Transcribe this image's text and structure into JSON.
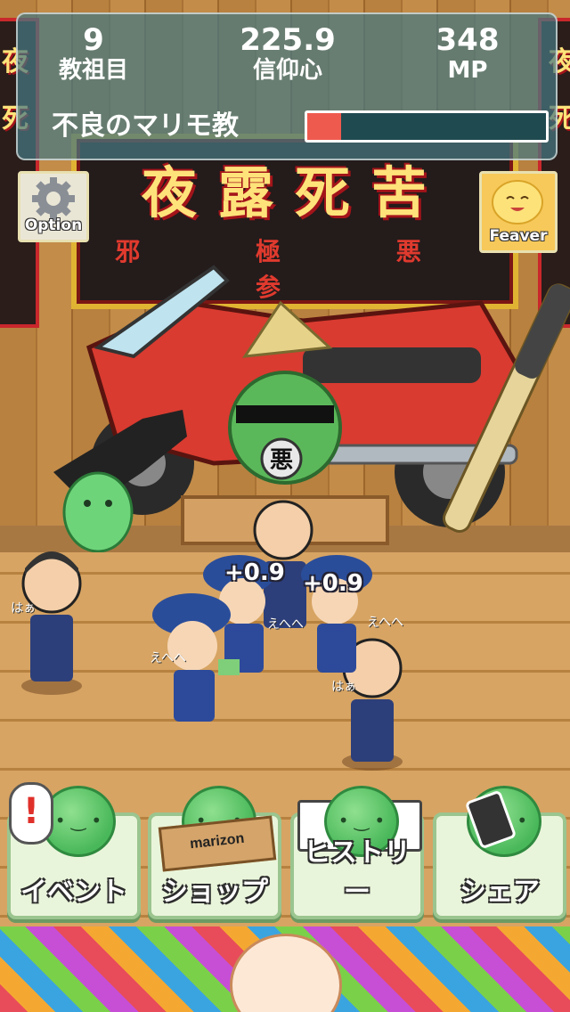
{
  "hud": {
    "stats": [
      {
        "value": "9",
        "label": "教祖目"
      },
      {
        "value": "225.9",
        "label": "信仰心"
      },
      {
        "value": "348",
        "label": "MP"
      }
    ],
    "cult_name": "不良のマリモ教",
    "progress": 0.14,
    "progress_color": "#ef5a4e"
  },
  "corner_buttons": {
    "option_label": "Option",
    "feaver_label": "Feaver"
  },
  "banner": {
    "main": "夜露死苦",
    "sub": "邪 極 悪 参"
  },
  "side_banners": {
    "left": [
      "夜",
      "死"
    ],
    "right": [
      "夜",
      "死"
    ]
  },
  "scene": {
    "marimo_mask_text": "悪",
    "floaters": [
      "+0.9",
      "+0.9"
    ],
    "murmurs": [
      "はぁ",
      "えへへ",
      "えへへ",
      "えへへ",
      "はぁ"
    ]
  },
  "menu": {
    "buttons": [
      {
        "label": "イベント",
        "icon": "alert-bubble-icon"
      },
      {
        "label": "ショップ",
        "icon": "box-icon"
      },
      {
        "label": "ヒストリー",
        "icon": "book-icon"
      },
      {
        "label": "シェア",
        "icon": "phone-icon"
      }
    ],
    "box_text": "marizon",
    "alert_mark": "!"
  },
  "colors": {
    "hud_bg": "#467882",
    "menu_green": "#49b85a",
    "banner_gold": "#e0b432"
  }
}
